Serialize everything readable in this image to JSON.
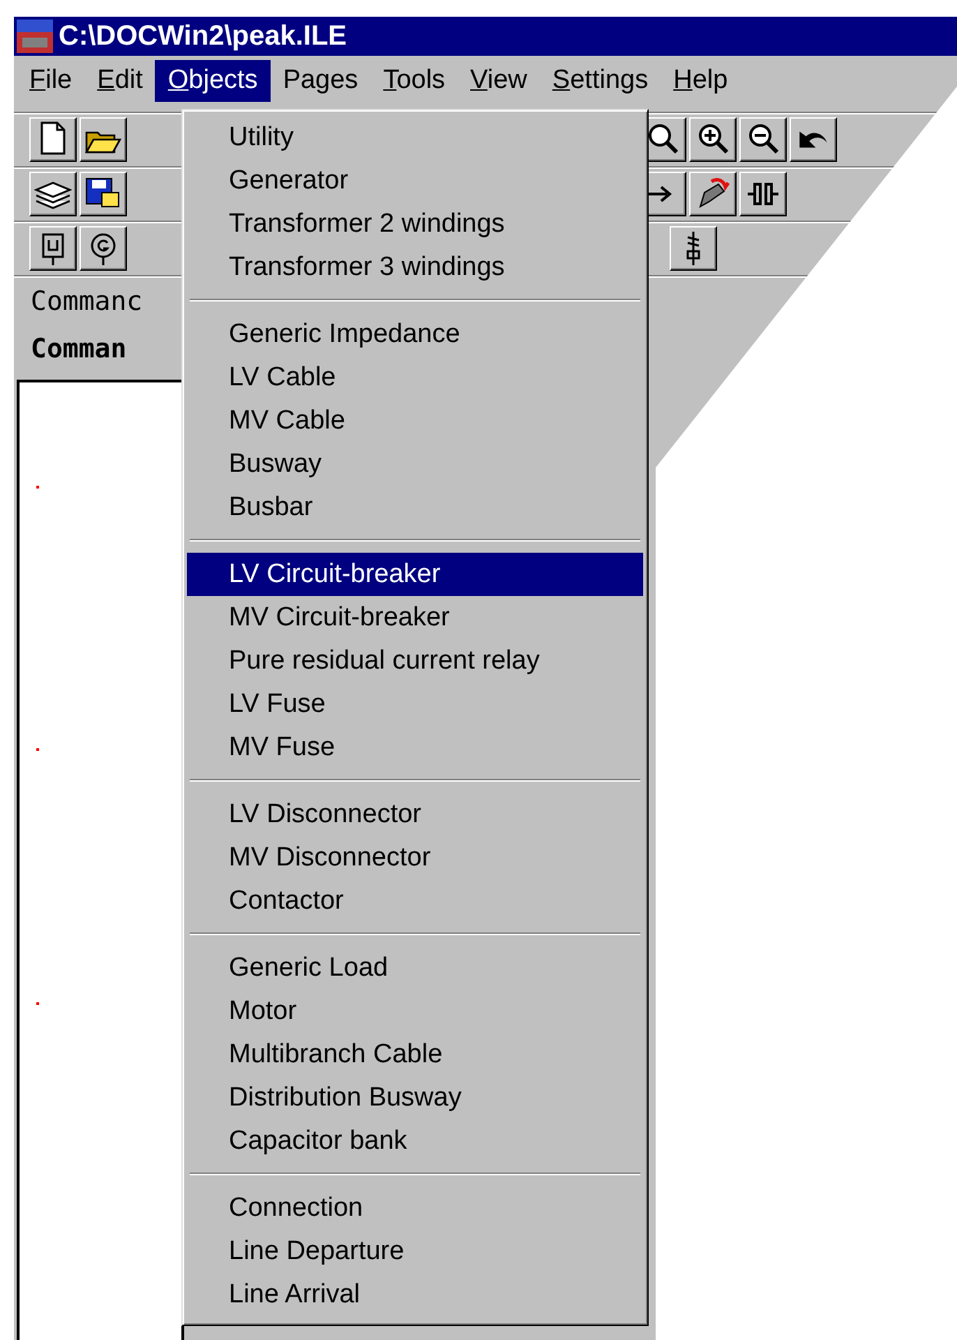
{
  "window": {
    "title": "C:\\DOCWin2\\peak.ILE"
  },
  "menu_bar": [
    {
      "label": "File",
      "underlined": true,
      "selected": false
    },
    {
      "label": "Edit",
      "underlined": true,
      "selected": false
    },
    {
      "label": "Objects",
      "underlined": true,
      "selected": true
    },
    {
      "label": "Pages",
      "underlined": false,
      "selected": false
    },
    {
      "label": "Tools",
      "underlined": true,
      "selected": false
    },
    {
      "label": "View",
      "underlined": true,
      "selected": false
    },
    {
      "label": "Settings",
      "underlined": true,
      "selected": false
    },
    {
      "label": "Help",
      "underlined": true,
      "selected": false
    }
  ],
  "command_labels": [
    {
      "text": "Commanc",
      "bold": false
    },
    {
      "text": "Comman",
      "bold": true
    }
  ],
  "objects_menu": {
    "groups": [
      {
        "items": [
          {
            "label": "Utility",
            "selected": false
          },
          {
            "label": "Generator",
            "selected": false
          },
          {
            "label": "Transformer 2 windings",
            "selected": false
          },
          {
            "label": "Transformer 3 windings",
            "selected": false
          }
        ]
      },
      {
        "items": [
          {
            "label": "Generic Impedance",
            "selected": false
          },
          {
            "label": "LV Cable",
            "selected": false
          },
          {
            "label": "MV Cable",
            "selected": false
          },
          {
            "label": "Busway",
            "selected": false
          },
          {
            "label": "Busbar",
            "selected": false
          }
        ]
      },
      {
        "items": [
          {
            "label": "LV Circuit-breaker",
            "selected": true
          },
          {
            "label": "MV Circuit-breaker",
            "selected": false
          },
          {
            "label": "Pure residual current relay",
            "selected": false
          },
          {
            "label": "LV Fuse",
            "selected": false
          },
          {
            "label": "MV Fuse",
            "selected": false
          }
        ]
      },
      {
        "items": [
          {
            "label": "LV Disconnector",
            "selected": false
          },
          {
            "label": "MV Disconnector",
            "selected": false
          },
          {
            "label": "Contactor",
            "selected": false
          }
        ]
      },
      {
        "items": [
          {
            "label": "Generic Load",
            "selected": false
          },
          {
            "label": "Motor",
            "selected": false
          },
          {
            "label": "Multibranch Cable",
            "selected": false
          },
          {
            "label": "Distribution Busway",
            "selected": false
          },
          {
            "label": "Capacitor bank",
            "selected": false
          }
        ]
      },
      {
        "items": [
          {
            "label": "Connection",
            "selected": false
          },
          {
            "label": "Line Departure",
            "selected": false
          },
          {
            "label": "Line Arrival",
            "selected": false
          }
        ]
      }
    ]
  }
}
